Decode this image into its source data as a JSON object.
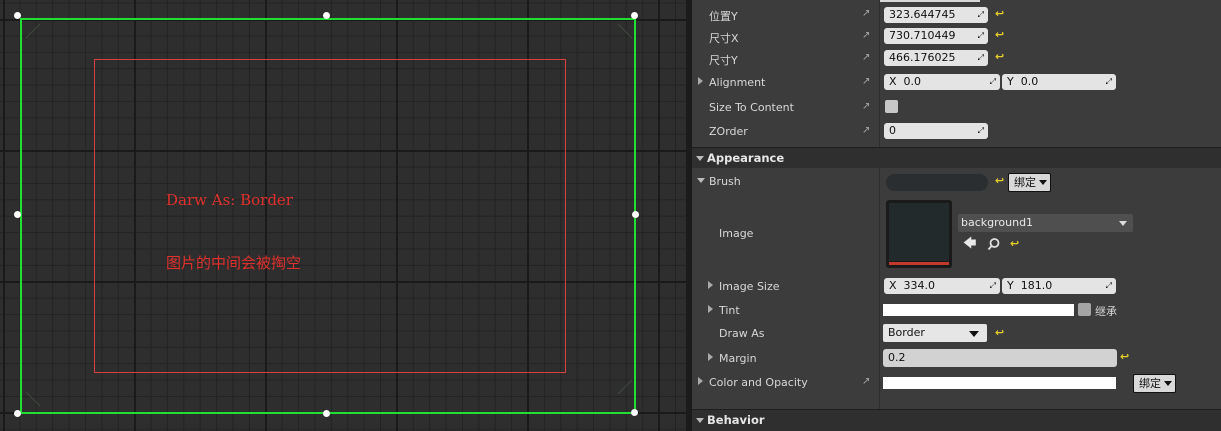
{
  "viewport": {
    "annotation_line1": "Darw As: Border",
    "annotation_line2": "图片的中间会被掏空",
    "selection_color": "#22dd33",
    "border_outline_color": "#d94040",
    "annotation_color": "#e0302c"
  },
  "details": {
    "position_y": {
      "label": "位置Y",
      "value": "323.644745"
    },
    "size_x": {
      "label": "尺寸X",
      "value": "730.710449"
    },
    "size_y": {
      "label": "尺寸Y",
      "value": "466.176025"
    },
    "alignment": {
      "label": "Alignment",
      "x_label": "X",
      "x_value": "0.0",
      "y_label": "Y",
      "y_value": "0.0"
    },
    "size_to_content": {
      "label": "Size To Content",
      "checked": false
    },
    "zorder": {
      "label": "ZOrder",
      "value": "0"
    },
    "appearance": {
      "header": "Appearance",
      "brush_label": "Brush",
      "bind_label": "绑定",
      "image_label": "Image",
      "image_asset": "background1",
      "image_size": {
        "label": "Image Size",
        "x_label": "X",
        "x_value": "334.0",
        "y_label": "Y",
        "y_value": "181.0"
      },
      "tint": {
        "label": "Tint",
        "inherit_label": "继承"
      },
      "draw_as": {
        "label": "Draw As",
        "value": "Border"
      },
      "margin": {
        "label": "Margin",
        "value": "0.2"
      },
      "color_and_opacity": {
        "label": "Color and Opacity",
        "bind_label": "绑定"
      }
    },
    "behavior": {
      "header": "Behavior"
    }
  }
}
